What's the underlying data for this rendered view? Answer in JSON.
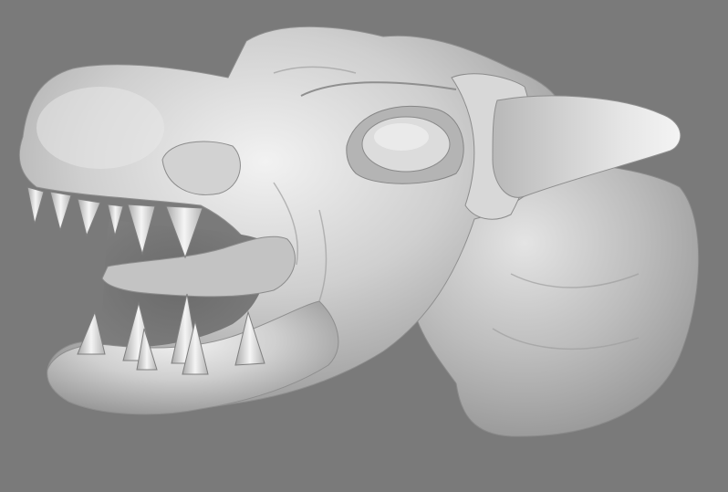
{
  "viewport": {
    "background_color": "#7a7a7a",
    "material_color": "#c9c9c9",
    "subject": "sculpted-creature-head-icon"
  }
}
